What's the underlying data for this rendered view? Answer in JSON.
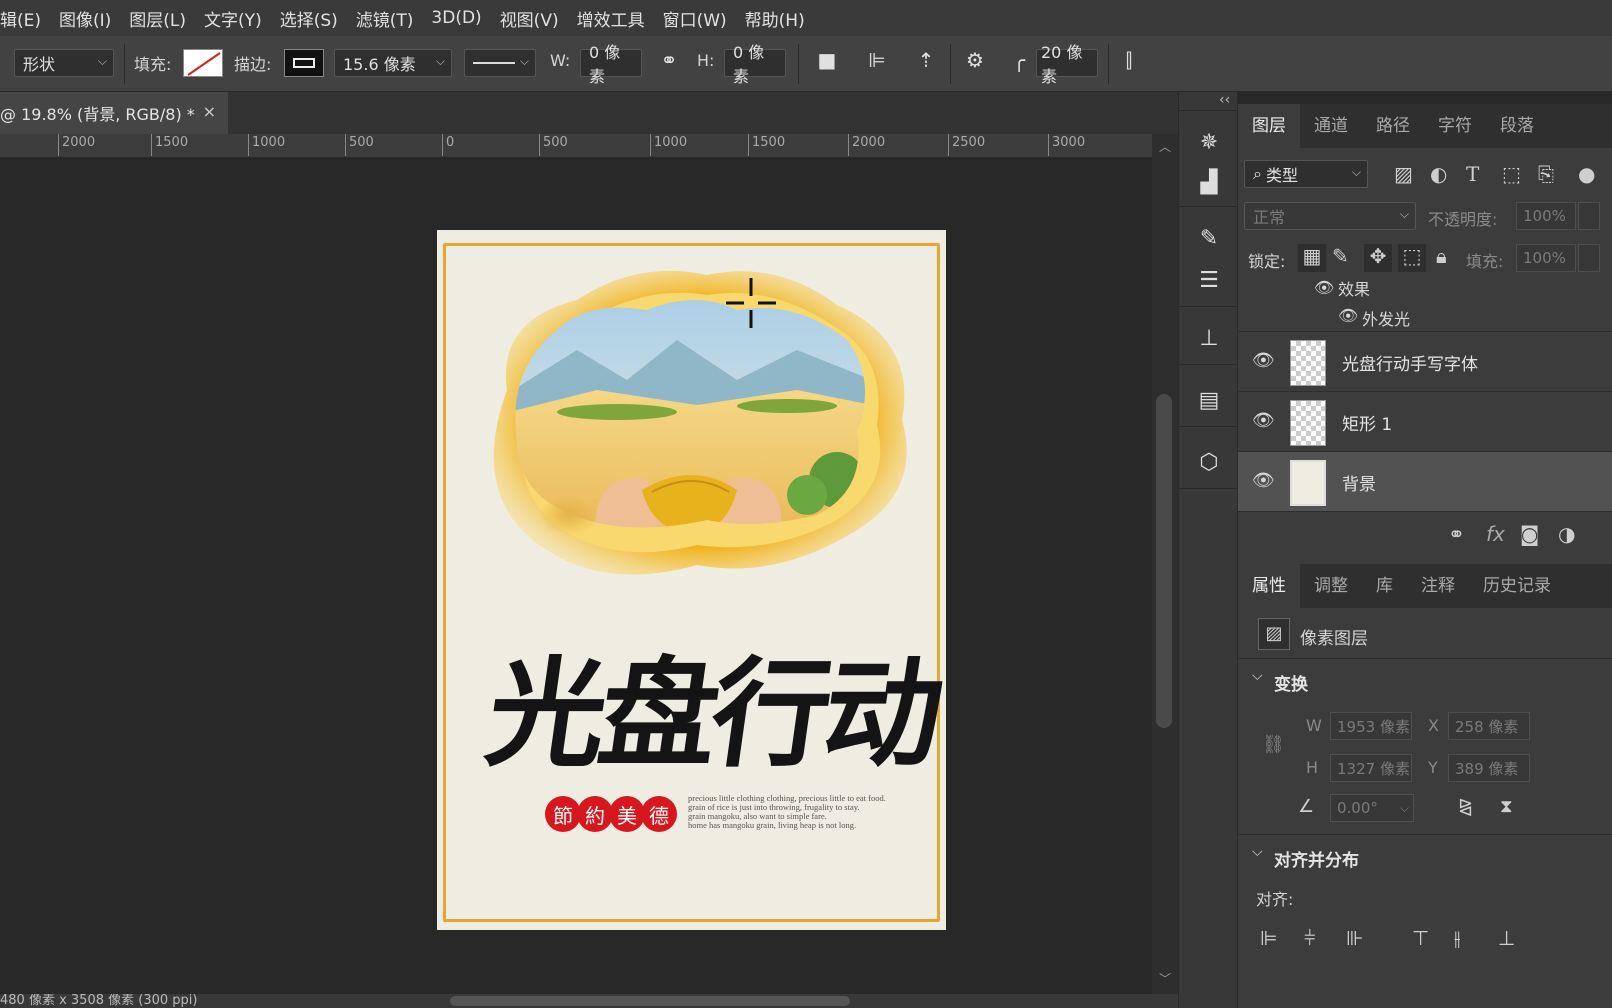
{
  "menu": [
    "辑(E)",
    "图像(I)",
    "图层(L)",
    "文字(Y)",
    "选择(S)",
    "滤镜(T)",
    "3D(D)",
    "视图(V)",
    "增效工具",
    "窗口(W)",
    "帮助(H)"
  ],
  "options": {
    "tool_mode": "形状",
    "fill_label": "填充:",
    "stroke_label": "描边:",
    "stroke_width": "15.6 像素",
    "w_label": "W:",
    "w_value": "0 像素",
    "h_label": "H:",
    "h_value": "0 像素",
    "corner_radius": "20 像素"
  },
  "document_tab": {
    "title": "@ 19.8% (背景, RGB/8) *",
    "close": "×"
  },
  "ruler": [
    "2000",
    "1500",
    "1000",
    "500",
    "0",
    "500",
    "1000",
    "1500",
    "2000",
    "2500",
    "3000"
  ],
  "poster": {
    "title": "光盘行动",
    "seals": [
      "節",
      "約",
      "美",
      "德"
    ],
    "english_lines": [
      "precious little clothing clothing, precious little to eat food.",
      "grain of rice is just into throwing, frugality to stay.",
      "grain mangoku, also want to simple fare.",
      "home has mangoku grain, living heap is not long."
    ]
  },
  "status_bar": "480 像素 x 3508 像素 (300 ppi)",
  "layers_panel": {
    "tabs": [
      "图层",
      "通道",
      "路径",
      "字符",
      "段落"
    ],
    "active_tab": "图层",
    "filter_type": "类型",
    "blend_mode": "正常",
    "opacity_label": "不透明度:",
    "opacity_value": "100%",
    "lock_label": "锁定:",
    "fill_label": "填充:",
    "fill_value": "100%",
    "effects_label": "效果",
    "effect_item": "外发光",
    "layers": [
      {
        "name": "光盘行动手写字体",
        "visible": true,
        "selected": false
      },
      {
        "name": "矩形 1",
        "visible": true,
        "selected": false
      },
      {
        "name": "背景",
        "visible": true,
        "selected": true
      }
    ],
    "fx_label": "fx"
  },
  "properties_panel": {
    "tabs": [
      "属性",
      "调整",
      "库",
      "注释",
      "历史记录"
    ],
    "active_tab": "属性",
    "layer_type": "像素图层",
    "transform_header": "变换",
    "w_label": "W",
    "w_value": "1953 像素",
    "x_label": "X",
    "x_value": "258 像素",
    "h_label": "H",
    "h_value": "1327 像素",
    "y_label": "Y",
    "y_value": "389 像素",
    "angle_value": "0.00°",
    "align_header": "对齐并分布",
    "align_label": "对齐:"
  },
  "colors": {
    "accent_gold": "#e5a634",
    "seal_red": "#d7171e",
    "poster_bg": "#efede1"
  }
}
